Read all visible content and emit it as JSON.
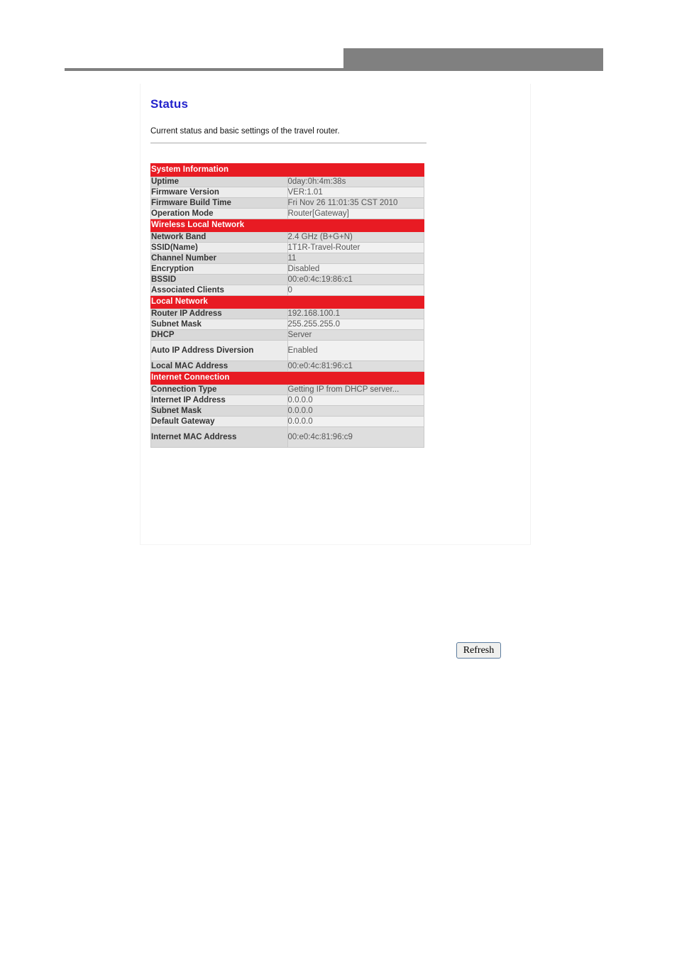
{
  "banner": {
    "block_color": "#808080",
    "rule_color": "#808080"
  },
  "page": {
    "title": "Status",
    "description": "Current status and basic settings of the travel router."
  },
  "theme": {
    "title_color": "#2222CC",
    "section_header_bg": "#E81B23",
    "section_header_text": "#FFFFFF",
    "row_dark_bg": "#DEDEDE",
    "row_light_bg": "#F1F1F1",
    "table_border": "#C9C9C9"
  },
  "status_table": {
    "sections": [
      {
        "header": "System Information",
        "rows": [
          {
            "label": "Uptime",
            "value": "0day:0h:4m:38s"
          },
          {
            "label": "Firmware Version",
            "value": "VER:1.01"
          },
          {
            "label": "Firmware Build Time",
            "value": "Fri Nov 26 11:01:35 CST 2010"
          },
          {
            "label": "Operation Mode",
            "value": "Router[Gateway]"
          }
        ]
      },
      {
        "header": "Wireless Local Network",
        "rows": [
          {
            "label": "Network Band",
            "value": "2.4 GHz (B+G+N)"
          },
          {
            "label": "SSID(Name)",
            "value": "1T1R-Travel-Router"
          },
          {
            "label": "Channel Number",
            "value": "11"
          },
          {
            "label": "Encryption",
            "value": "Disabled"
          },
          {
            "label": "BSSID",
            "value": "00:e0:4c:19:86:c1"
          },
          {
            "label": "Associated Clients",
            "value": "0"
          }
        ]
      },
      {
        "header": "Local Network",
        "rows": [
          {
            "label": "Router IP Address",
            "value": "192.168.100.1"
          },
          {
            "label": "Subnet Mask",
            "value": "255.255.255.0"
          },
          {
            "label": "DHCP",
            "value": "Server"
          },
          {
            "label": "Auto IP Address Diversion",
            "value": "Enabled",
            "tall": true
          },
          {
            "label": "Local MAC Address",
            "value": "00:e0:4c:81:96:c1"
          }
        ]
      },
      {
        "header": "Internet Connection",
        "rows": [
          {
            "label": "Connection Type",
            "value": "Getting IP from DHCP server..."
          },
          {
            "label": "Internet IP Address",
            "value": "0.0.0.0"
          },
          {
            "label": "Subnet Mask",
            "value": "0.0.0.0"
          },
          {
            "label": "Default Gateway",
            "value": "0.0.0.0"
          },
          {
            "label": "Internet MAC Address",
            "value": "00:e0:4c:81:96:c9",
            "tall": true
          }
        ]
      }
    ]
  },
  "actions": {
    "refresh_label": "Refresh"
  }
}
